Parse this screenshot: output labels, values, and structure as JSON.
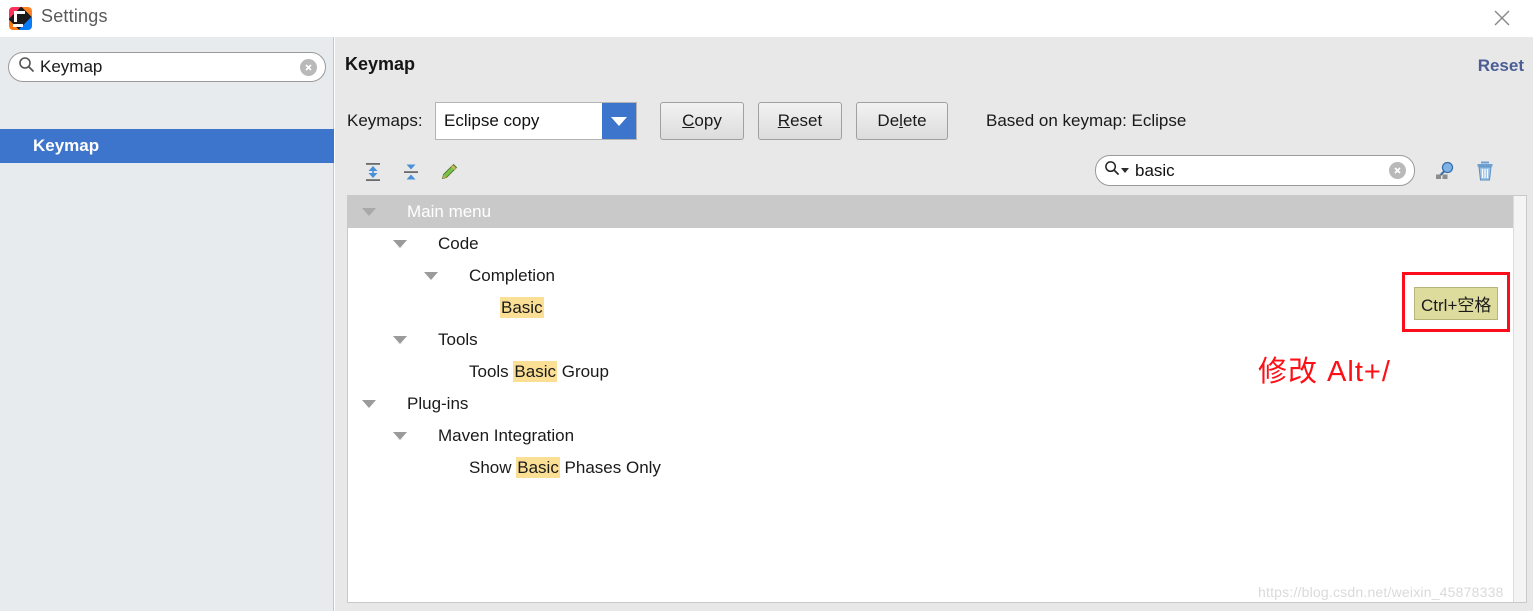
{
  "window": {
    "title": "Settings",
    "logo_icon": "intellij-idea-logo",
    "close_icon": "close-icon"
  },
  "sidebar": {
    "search": {
      "value": "Keymap",
      "placeholder": "",
      "icon": "search-icon",
      "clear_icon": "clear-icon"
    },
    "items": [
      {
        "label": "Keymap",
        "selected": true
      }
    ]
  },
  "main": {
    "page_title": "Keymap",
    "reset_link": "Reset",
    "keymaps_label": "Keymaps:",
    "keymap_selected": "Eclipse copy",
    "dropdown_icon": "chevron-down-icon",
    "buttons": [
      {
        "name": "copy",
        "pre": "",
        "mnemonic": "C",
        "post": "opy"
      },
      {
        "name": "reset",
        "pre": "",
        "mnemonic": "R",
        "post": "eset"
      },
      {
        "name": "delete",
        "pre": "De",
        "mnemonic": "l",
        "post": "ete"
      }
    ],
    "based_on": "Based on keymap: Eclipse",
    "toolbar_icons": [
      {
        "name": "expand-all-icon"
      },
      {
        "name": "collapse-all-icon"
      },
      {
        "name": "edit-shortcut-pencil-icon"
      }
    ],
    "tree_search": {
      "value": "basic",
      "icon": "search-icon",
      "clear_icon": "clear-icon"
    },
    "filter_icon": "find-by-shortcut-icon",
    "trash_icon": "trash-icon"
  },
  "tree": [
    {
      "indent": 0,
      "arrow": true,
      "header": true,
      "parts": [
        {
          "t": "Main menu",
          "hl": false
        }
      ]
    },
    {
      "indent": 1,
      "arrow": true,
      "header": false,
      "parts": [
        {
          "t": "Code",
          "hl": false
        }
      ]
    },
    {
      "indent": 2,
      "arrow": true,
      "header": false,
      "parts": [
        {
          "t": "Completion",
          "hl": false
        }
      ]
    },
    {
      "indent": 3,
      "arrow": false,
      "header": false,
      "parts": [
        {
          "t": "Basic",
          "hl": true
        }
      ]
    },
    {
      "indent": 1,
      "arrow": true,
      "header": false,
      "parts": [
        {
          "t": "Tools",
          "hl": false
        }
      ]
    },
    {
      "indent": 2,
      "arrow": false,
      "header": false,
      "parts": [
        {
          "t": "Tools ",
          "hl": false
        },
        {
          "t": "Basic",
          "hl": true
        },
        {
          "t": " Group",
          "hl": false
        }
      ]
    },
    {
      "indent": 0,
      "arrow": true,
      "header": false,
      "parts": [
        {
          "t": "Plug-ins",
          "hl": false
        }
      ]
    },
    {
      "indent": 1,
      "arrow": true,
      "header": false,
      "parts": [
        {
          "t": "Maven Integration",
          "hl": false
        }
      ]
    },
    {
      "indent": 2,
      "arrow": false,
      "header": false,
      "parts": [
        {
          "t": "Show ",
          "hl": false
        },
        {
          "t": "Basic",
          "hl": true
        },
        {
          "t": " Phases Only",
          "hl": false
        }
      ]
    }
  ],
  "annotations": {
    "shortcut_badge": "Ctrl+空格",
    "note": "修改 Alt+/",
    "box_color": "#fc0d1b",
    "note_color": "#fc1016"
  },
  "watermark": "https://blog.csdn.net/weixin_45878338"
}
